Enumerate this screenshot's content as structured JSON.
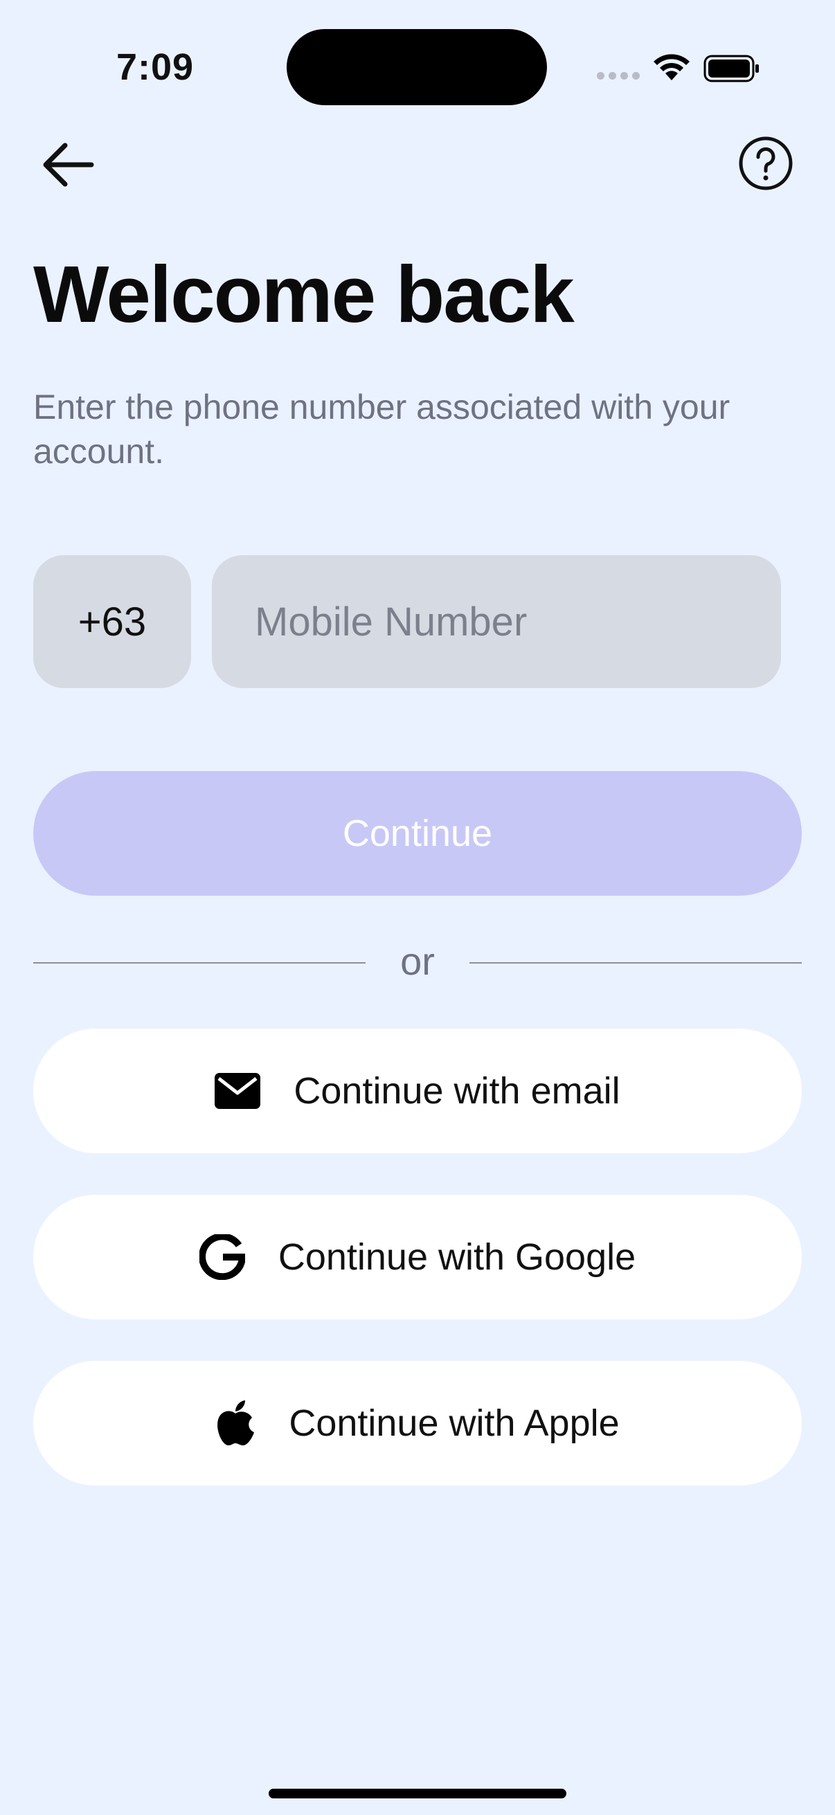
{
  "status_bar": {
    "time": "7:09"
  },
  "header": {
    "title": "Welcome back",
    "subtitle": "Enter the phone number associated with your account."
  },
  "phone": {
    "country_code": "+63",
    "placeholder": "Mobile Number",
    "value": ""
  },
  "buttons": {
    "continue": "Continue",
    "divider": "or",
    "email": "Continue with email",
    "google": "Continue with Google",
    "apple": "Continue with Apple"
  },
  "colors": {
    "background": "#EBF2FF",
    "continue_disabled": "#C8C8F7",
    "input_bg": "#D6DBE3"
  },
  "icons": [
    "back-arrow-icon",
    "help-icon",
    "mail-icon",
    "google-icon",
    "apple-icon",
    "wifi-icon",
    "battery-icon"
  ]
}
